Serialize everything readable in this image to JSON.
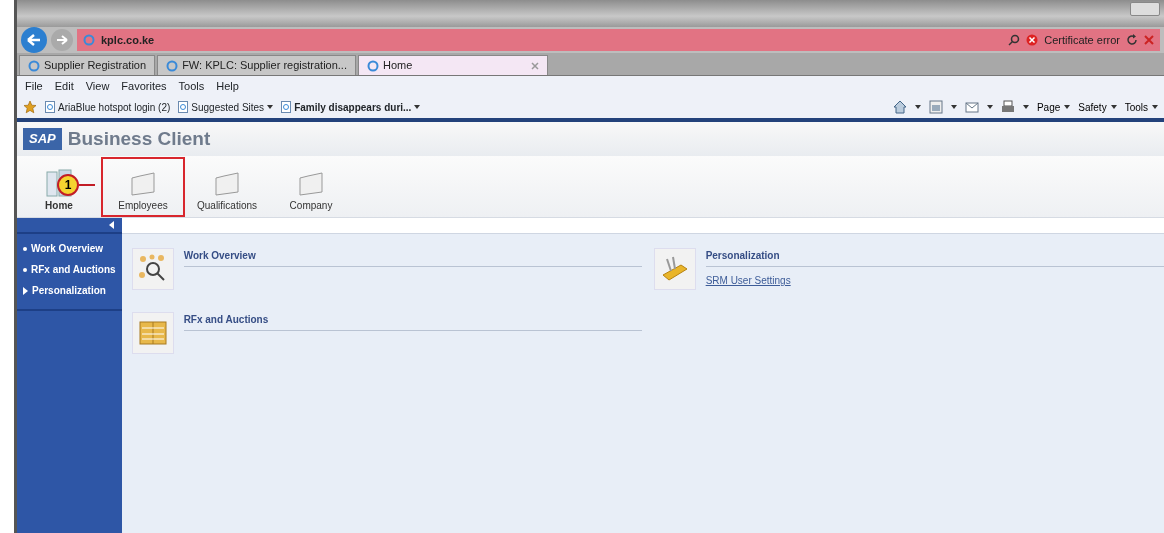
{
  "browser": {
    "address": "kplc.co.ke",
    "certificate": "Certificate error",
    "tabs": [
      {
        "label": "Supplier Registration",
        "selected": false
      },
      {
        "label": "FW: KPLC: Supplier registration...",
        "selected": false
      },
      {
        "label": "Home",
        "selected": true
      }
    ],
    "menu": [
      "File",
      "Edit",
      "View",
      "Favorites",
      "Tools",
      "Help"
    ],
    "favorites": [
      {
        "label": "AriaBlue hotspot  login (2)",
        "dropdown": false,
        "bold": false
      },
      {
        "label": "Suggested Sites",
        "dropdown": true,
        "bold": false
      },
      {
        "label": "Family disappears duri...",
        "dropdown": true,
        "bold": true
      }
    ],
    "command_bar": [
      "Page",
      "Safety",
      "Tools"
    ]
  },
  "app": {
    "brand": "SAP",
    "title": "Business Client",
    "nav": [
      {
        "label": "Home",
        "kind": "home",
        "selected": true,
        "highlighted": false
      },
      {
        "label": "Employees",
        "kind": "folder",
        "selected": false,
        "highlighted": true
      },
      {
        "label": "Qualifications",
        "kind": "folder",
        "selected": false,
        "highlighted": false
      },
      {
        "label": "Company",
        "kind": "folder",
        "selected": false,
        "highlighted": false
      }
    ],
    "callout": "1",
    "sidebar": [
      {
        "label": "Work Overview",
        "kind": "bullet"
      },
      {
        "label": "RFx and Auctions",
        "kind": "bullet"
      },
      {
        "label": "Personalization",
        "kind": "expand"
      }
    ],
    "columns": [
      [
        {
          "title": "Work Overview",
          "kind": "network"
        },
        {
          "title": "RFx and Auctions",
          "kind": "ledger"
        }
      ],
      [
        {
          "title": "Personalization",
          "kind": "knife",
          "links": [
            "SRM User Settings"
          ]
        }
      ]
    ]
  }
}
